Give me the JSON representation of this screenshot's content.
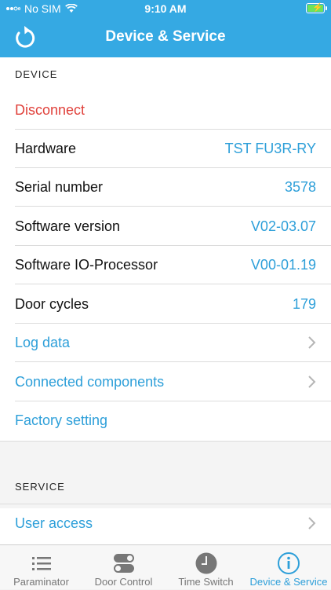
{
  "status_bar": {
    "carrier": "No SIM",
    "time": "9:10 AM"
  },
  "nav": {
    "title": "Device & Service"
  },
  "device": {
    "header": "DEVICE",
    "disconnect": "Disconnect",
    "rows": [
      {
        "label": "Hardware",
        "value": "TST FU3R-RY"
      },
      {
        "label": "Serial number",
        "value": "3578"
      },
      {
        "label": "Software version",
        "value": "V02-03.07"
      },
      {
        "label": "Software IO-Processor",
        "value": "V00-01.19"
      },
      {
        "label": "Door cycles",
        "value": "179"
      }
    ],
    "log_data": "Log data",
    "connected_components": "Connected components",
    "factory_setting": "Factory setting"
  },
  "service": {
    "header": "SERVICE",
    "user_access": "User access"
  },
  "tabs": [
    {
      "label": "Paraminator",
      "icon": "list-icon"
    },
    {
      "label": "Door Control",
      "icon": "toggles-icon"
    },
    {
      "label": "Time Switch",
      "icon": "clock-icon"
    },
    {
      "label": "Device & Service",
      "icon": "info-icon",
      "active": true
    }
  ],
  "colors": {
    "accent": "#35a9e3",
    "link": "#2d9fd9",
    "destructive": "#e0413b"
  }
}
